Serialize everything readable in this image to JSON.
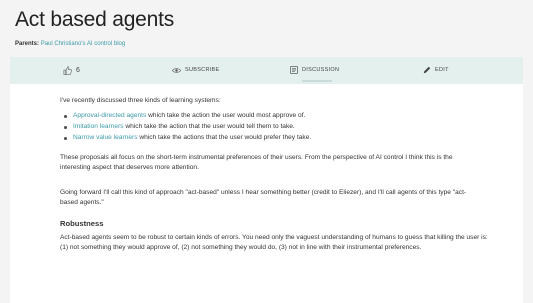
{
  "page": {
    "title": "Act based agents",
    "parents_label": "Parents:",
    "parents_link": "Paul Christiano's AI control blog"
  },
  "toolbar": {
    "like_count": "6",
    "subscribe_label": "SUBSCRIBE",
    "discussion_label": "DISCUSSION",
    "edit_label": "EDIT"
  },
  "article": {
    "intro": "I've recently discussed three kinds of learning systems:",
    "bullets": [
      {
        "link": "Approval-directed agents",
        "rest": " which take the action the user would most approve of."
      },
      {
        "link": "Imitation learners",
        "rest": " which take the action that the user would tell them to take."
      },
      {
        "link": "Narrow value learners",
        "rest": " which take the actions that the user would prefer they take."
      }
    ],
    "para2": "These proposals all focus on the short-term instrumental preferences of their users. From the perspective of AI control I think this is the interesting aspect that deserves more attention.",
    "para3": "Going forward I'll call this kind of approach \"act-based\" unless I hear something better (credit to Eliezer), and I'll call agents of this type \"act-based agents.\"",
    "robustness_heading": "Robustness",
    "para4": "Act-based agents seem to be robust to certain kinds of errors. You need only the vaguest understanding of humans to guess that killing the user is: (1) not something they would approve of, (2) not something they would do, (3) not in line with their instrumental preferences."
  }
}
